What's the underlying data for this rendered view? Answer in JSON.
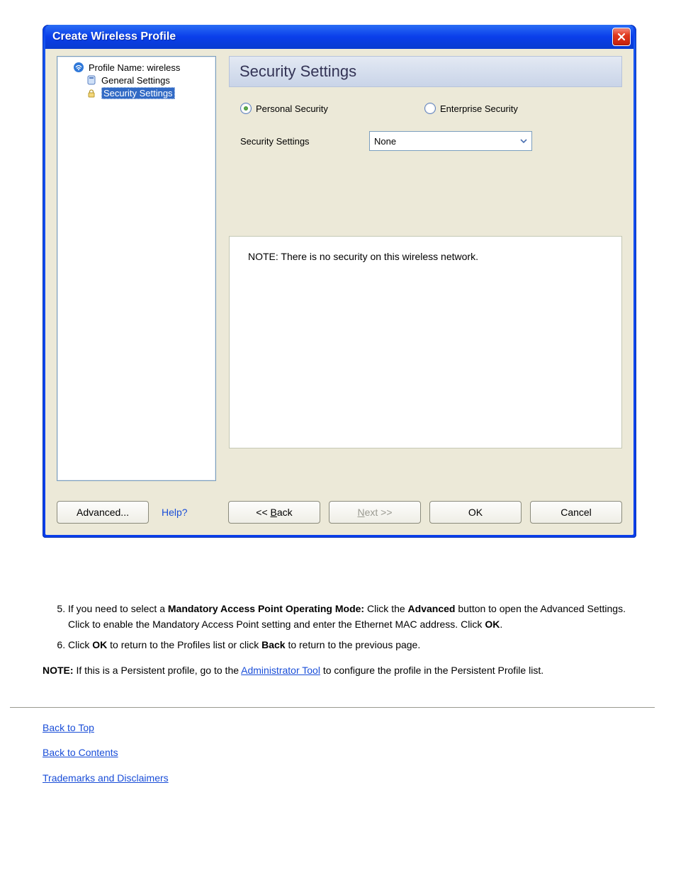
{
  "window": {
    "title": "Create Wireless Profile"
  },
  "tree": {
    "profile_label": "Profile Name: wireless",
    "general_label": "General Settings",
    "security_label": "Security Settings"
  },
  "panel": {
    "title": "Security Settings",
    "radio_personal": "Personal Security",
    "radio_enterprise": "Enterprise Security",
    "settings_label": "Security Settings",
    "combo_value": "None",
    "note_text": "NOTE: There is no security on this wireless network."
  },
  "buttons": {
    "advanced": "Advanced...",
    "help": "Help?",
    "back_pre": "<< ",
    "back_u": "B",
    "back_post": "ack",
    "next_u": "N",
    "next_post": "ext >>",
    "ok": "OK",
    "cancel": "Cancel"
  },
  "below": {
    "li5_pre": "If you need to select a ",
    "li5_b": "Mandatory Access Point Operating Mode: ",
    "li5_post": "Click the ",
    "li5_b2": "Advanced",
    "li5_post2": " button to open the Advanced Settings. Click to enable the Mandatory Access Point setting and enter the Ethernet MAC address. Click ",
    "li5_b3": "OK",
    "li5_tail": ".",
    "li6_pre": "Click ",
    "li6_b": "OK",
    "li6_post": " to return to the Profiles list or click ",
    "li6_b2": "Back",
    "li6_post2": " to return to the previous page.",
    "note_b": "NOTE:",
    "note_text": " If this is a Persistent profile, go to the ",
    "note_link": "Administrator Tool",
    "note_tail": " to configure the profile in the Persistent Profile list."
  },
  "footer": {
    "back_to_top": "Back to Top",
    "back_to_contents": "Back to Contents",
    "trademarks": "Trademarks and Disclaimers"
  }
}
